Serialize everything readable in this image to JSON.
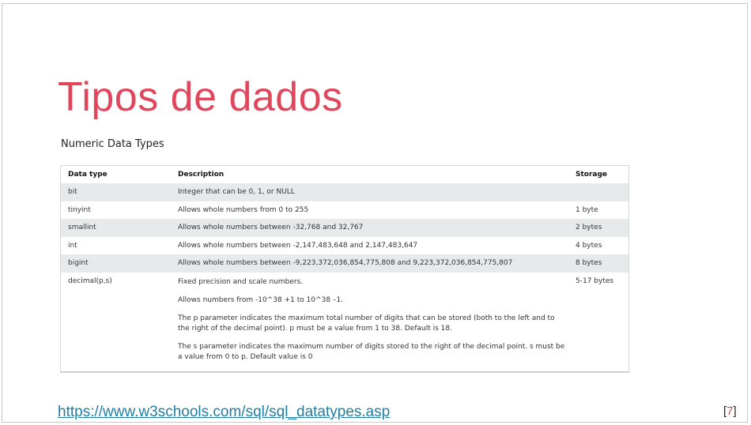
{
  "slide": {
    "title": "Tipos de dados",
    "subtitle": "Numeric Data Types",
    "link": "https://www.w3schools.com/sql/sql_datatypes.asp",
    "page_open": "[",
    "page_number": "7",
    "page_close": "]"
  },
  "table": {
    "headers": [
      "Data type",
      "Description",
      "Storage"
    ],
    "rows": [
      {
        "type": "bit",
        "desc": "Integer that can be 0, 1, or NULL",
        "storage": ""
      },
      {
        "type": "tinyint",
        "desc": "Allows whole numbers from 0 to 255",
        "storage": "1 byte"
      },
      {
        "type": "smallint",
        "desc": "Allows whole numbers between -32,768 and 32,767",
        "storage": "2 bytes"
      },
      {
        "type": "int",
        "desc": "Allows whole numbers between -2,147,483,648 and 2,147,483,647",
        "storage": "4 bytes"
      },
      {
        "type": "bigint",
        "desc": "Allows whole numbers between -9,223,372,036,854,775,808 and 9,223,372,036,854,775,807",
        "storage": "8 bytes"
      },
      {
        "type": "decimal(p,s)",
        "desc_lines": [
          "Fixed precision and scale numbers.",
          "Allows numbers from -10^38 +1 to 10^38 –1.",
          "The p parameter indicates the maximum total number of digits that can be stored (both to the left and to the right of the decimal point). p must be a value from 1 to 38. Default is 18.",
          "The s parameter indicates the maximum number of digits stored to the right of the decimal point. s must be a value from 0 to p. Default value is 0"
        ],
        "storage": "5-17 bytes"
      }
    ]
  }
}
